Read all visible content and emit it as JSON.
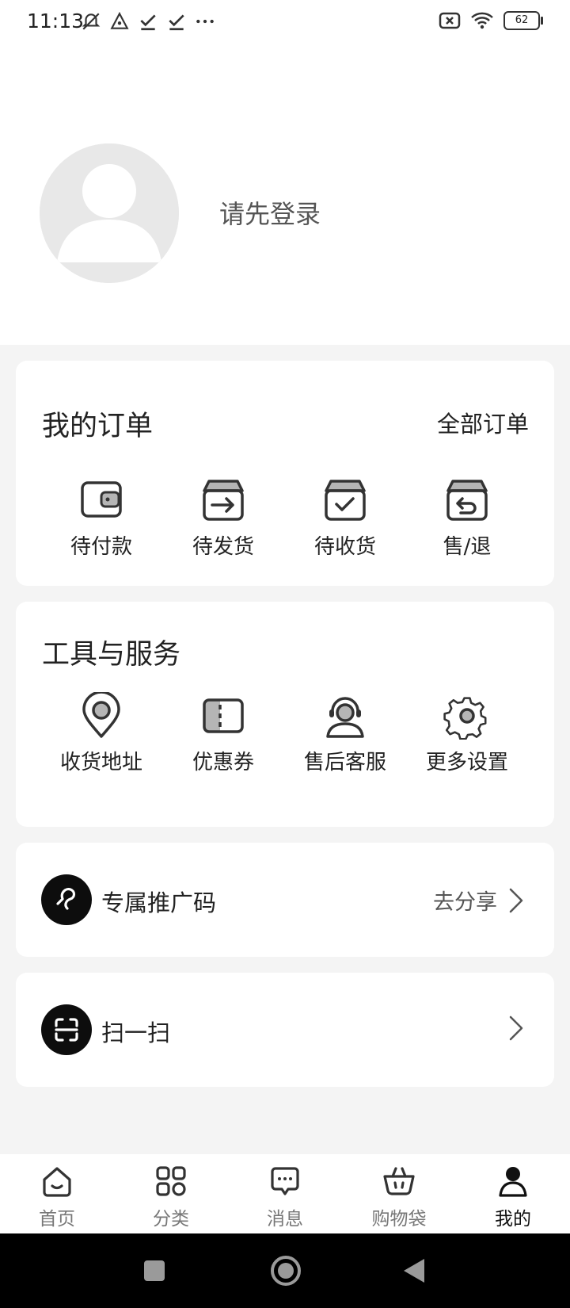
{
  "status_bar": {
    "time": "11:13",
    "battery": "62"
  },
  "profile": {
    "login_prompt": "请先登录"
  },
  "orders": {
    "title": "我的订单",
    "all_orders": "全部订单",
    "items": [
      {
        "label": "待付款",
        "icon": "wallet-icon"
      },
      {
        "label": "待发货",
        "icon": "box-arrow-icon"
      },
      {
        "label": "待收货",
        "icon": "box-check-icon"
      },
      {
        "label": "售/退",
        "icon": "box-return-icon"
      }
    ]
  },
  "tools": {
    "title": "工具与服务",
    "items": [
      {
        "label": "收货地址",
        "icon": "location-pin-icon"
      },
      {
        "label": "优惠券",
        "icon": "coupon-icon"
      },
      {
        "label": "售后客服",
        "icon": "customer-service-icon"
      },
      {
        "label": "更多设置",
        "icon": "gear-icon"
      }
    ]
  },
  "promo": {
    "label": "专属推广码",
    "action": "去分享"
  },
  "scan": {
    "label": "扫一扫"
  },
  "tabs": [
    {
      "label": "首页",
      "icon": "home-icon"
    },
    {
      "label": "分类",
      "icon": "category-icon"
    },
    {
      "label": "消息",
      "icon": "message-icon"
    },
    {
      "label": "购物袋",
      "icon": "basket-icon"
    },
    {
      "label": "我的",
      "icon": "user-icon",
      "active": true
    }
  ],
  "colors": {
    "background": "#f4f4f4",
    "card": "#ffffff",
    "text": "#222222",
    "secondary_text": "#555555",
    "icon_black": "#0d0d0d",
    "icon_grey_fill": "#b5b5b5"
  }
}
